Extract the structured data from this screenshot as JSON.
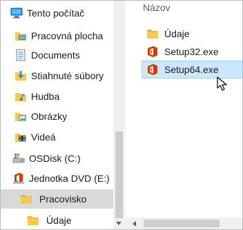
{
  "navigation": {
    "items": [
      {
        "label": "Tento počítač",
        "icon": "computer-icon"
      },
      {
        "label": "Pracovná plocha",
        "icon": "desktop-folder-icon"
      },
      {
        "label": "Documents",
        "icon": "documents-folder-icon"
      },
      {
        "label": "Stiahnuté súbory",
        "icon": "downloads-folder-icon"
      },
      {
        "label": "Hudba",
        "icon": "music-folder-icon"
      },
      {
        "label": "Obrázky",
        "icon": "pictures-folder-icon"
      },
      {
        "label": "Videá",
        "icon": "videos-folder-icon"
      },
      {
        "label": "OSDisk (C:)",
        "icon": "drive-icon"
      },
      {
        "label": "Jednotka DVD (E:)",
        "icon": "office-dvd-icon"
      },
      {
        "label": "Pracovisko",
        "icon": "folder-icon",
        "selected": true
      },
      {
        "label": "Údaje",
        "icon": "folder-icon"
      }
    ]
  },
  "content": {
    "column_header": "Názov",
    "files": [
      {
        "label": "Údaje",
        "icon": "folder-icon"
      },
      {
        "label": "Setup32.exe",
        "icon": "office-setup-icon"
      },
      {
        "label": "Setup64.exe",
        "icon": "office-setup-icon",
        "selected": true
      }
    ]
  },
  "colors": {
    "selection_blue": "#cce8ff",
    "selection_border": "#99d1ff",
    "nav_selected": "#d9d9d9",
    "folder_yellow": "#f8c94e",
    "office_red": "#d83b01",
    "header_text": "#4c607a"
  }
}
